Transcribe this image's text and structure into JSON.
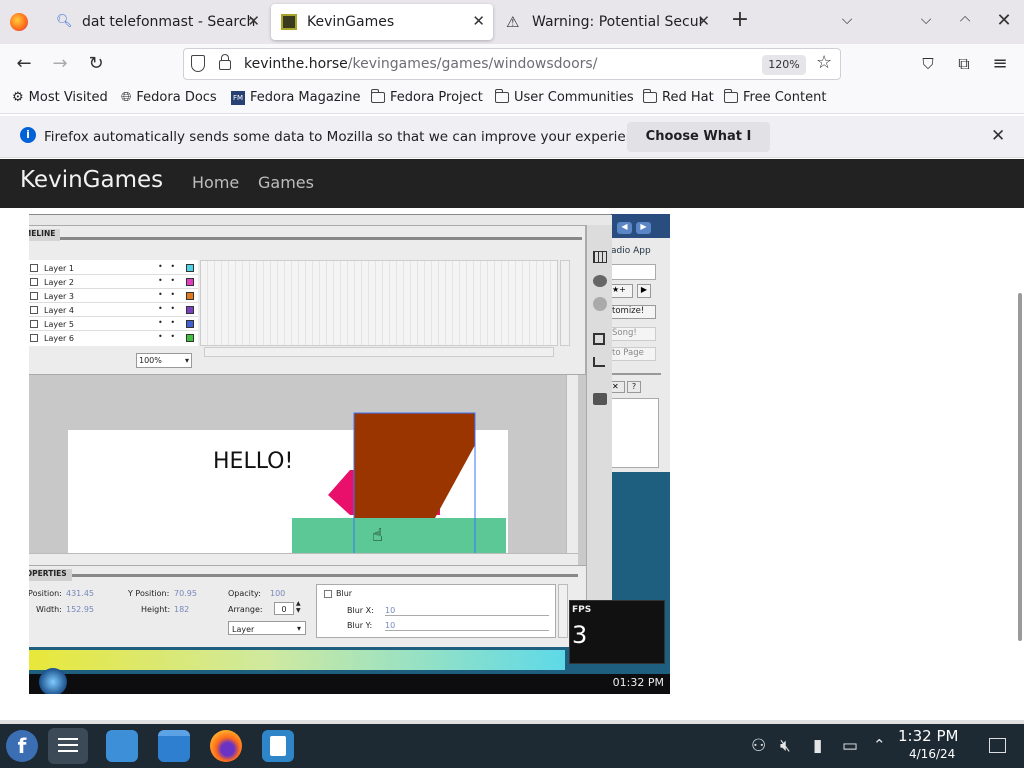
{
  "tabs": [
    {
      "title": "dat telefonmast - Search",
      "icon": "search-icon",
      "active": false
    },
    {
      "title": "KevinGames",
      "icon": "kevingames-favicon",
      "active": true
    },
    {
      "title": "Warning: Potential Security Risk",
      "icon": "warning-icon",
      "active": false
    }
  ],
  "url": {
    "domain": "kevinthe.horse",
    "path": "/kevingames/games/windowsdoors/",
    "zoom": "120%"
  },
  "bookmarks": [
    "Most Visited",
    "Fedora Docs",
    "Fedora Magazine",
    "Fedora Project",
    "User Communities",
    "Red Hat",
    "Free Content"
  ],
  "notification": {
    "text": "Firefox automatically sends some data to Mozilla so that we can improve your experience.",
    "button": "Choose What I Share"
  },
  "site": {
    "brand": "KevinGames",
    "nav": [
      "Home",
      "Games"
    ]
  },
  "game": {
    "timeline_label": "IMELINE",
    "layers": [
      "Layer 1",
      "Layer 2",
      "Layer 3",
      "Layer 4",
      "Layer 5",
      "Layer 6"
    ],
    "layer_colors": [
      "#4fd2e6",
      "#e040c0",
      "#e07820",
      "#7a40c0",
      "#4060d0",
      "#40c040"
    ],
    "zoom": "100%",
    "canvas_text": "HELLO!",
    "properties_label": "ROPERTIES",
    "props": {
      "x_label": "X Position:",
      "x_value": "431.45",
      "y_label": "Y Position:",
      "y_value": "70.95",
      "w_label": "Width:",
      "w_value": "152.95",
      "h_label": "Height:",
      "h_value": "182",
      "opacity_label": "Opacity:",
      "opacity_value": "100",
      "arrange_label": "Arrange:",
      "arrange_value": "0",
      "layer_select": "Layer"
    },
    "blur": {
      "label": "Blur",
      "x_label": "Blur X:",
      "x_value": "10",
      "y_label": "Blur Y:",
      "y_value": "10"
    },
    "radio": {
      "title": "adio App",
      "customize": "tomize!",
      "song": "Song!",
      "page": "to Page",
      "help": "?"
    },
    "fps_label": "FPS",
    "fps_value": "3",
    "clock": "01:32 PM"
  },
  "os": {
    "time": "1:32 PM",
    "date": "4/16/24"
  }
}
